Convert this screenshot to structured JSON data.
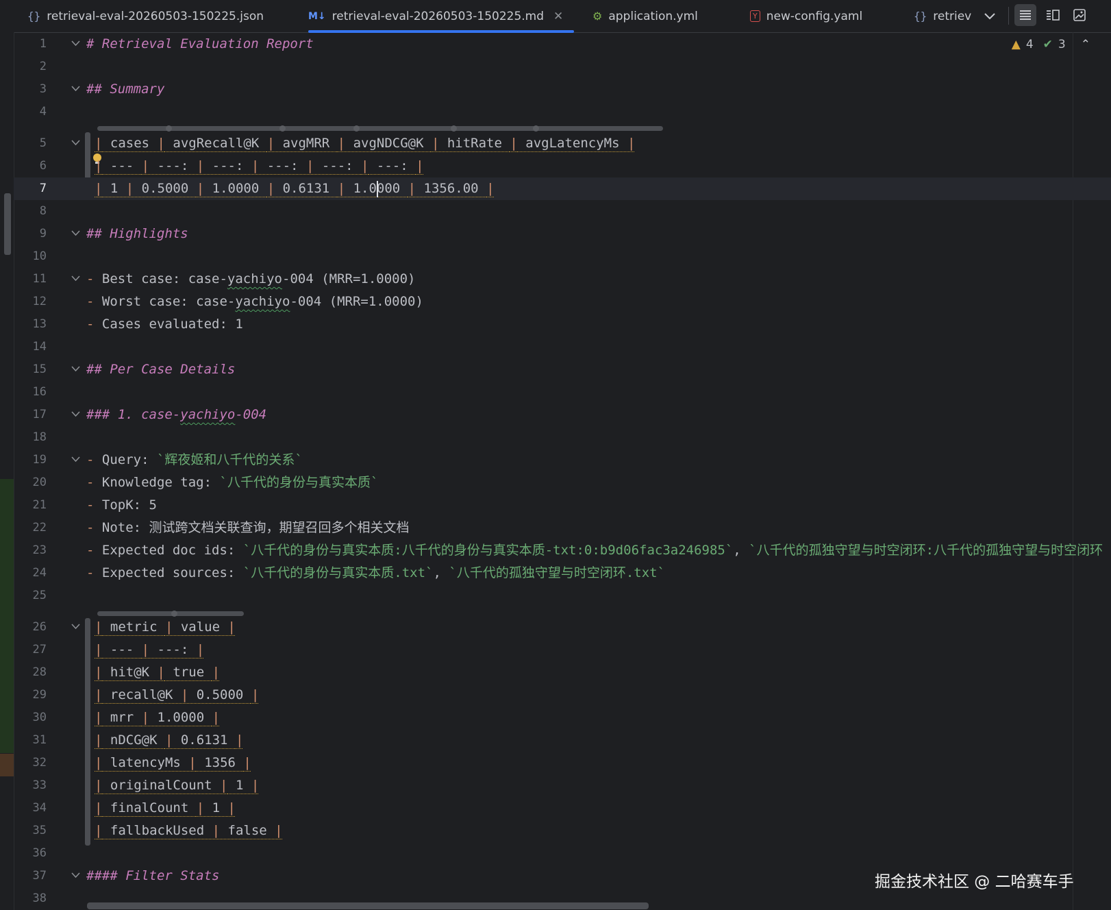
{
  "tabs": [
    {
      "label": "retrieval-eval-20260503-150225.json",
      "icon": "json-file-icon"
    },
    {
      "label": "retrieval-eval-20260503-150225.md",
      "icon": "markdown-file-icon",
      "active": true
    },
    {
      "label": "application.yml",
      "icon": "yml-file-icon"
    },
    {
      "label": "new-config.yaml",
      "icon": "yaml-file-icon"
    },
    {
      "label": "retriev",
      "icon": "json-file-icon"
    }
  ],
  "inspections": {
    "warnings": "4",
    "ok": "3"
  },
  "code_lines": [
    {
      "n": "1",
      "text": "# Retrieval Evaluation Report"
    },
    {
      "n": "2",
      "text": ""
    },
    {
      "n": "3",
      "text": "## Summary"
    },
    {
      "n": "4",
      "text": ""
    },
    {
      "n": "5",
      "text": "| cases | avgRecall@K | avgMRR | avgNDCG@K | hitRate | avgLatencyMs |"
    },
    {
      "n": "6",
      "text": "| --- | ---: | ---: | ---: | ---: | ---: |"
    },
    {
      "n": "7",
      "text": "| 1 | 0.5000 | 1.0000 | 0.6131 | 1.0000 | 1356.00 |"
    },
    {
      "n": "8",
      "text": ""
    },
    {
      "n": "9",
      "text": "## Highlights"
    },
    {
      "n": "10",
      "text": ""
    },
    {
      "n": "11",
      "text": "- Best case: case-yachiyo-004 (MRR=1.0000)"
    },
    {
      "n": "12",
      "text": "- Worst case: case-yachiyo-004 (MRR=1.0000)"
    },
    {
      "n": "13",
      "text": "- Cases evaluated: 1"
    },
    {
      "n": "14",
      "text": ""
    },
    {
      "n": "15",
      "text": "## Per Case Details"
    },
    {
      "n": "16",
      "text": ""
    },
    {
      "n": "17",
      "text": "### 1. case-yachiyo-004"
    },
    {
      "n": "18",
      "text": ""
    },
    {
      "n": "19",
      "text": "- Query: `辉夜姬和八千代的关系`"
    },
    {
      "n": "20",
      "text": "- Knowledge tag: `八千代的身份与真实本质`"
    },
    {
      "n": "21",
      "text": "- TopK: 5"
    },
    {
      "n": "22",
      "text": "- Note: 测试跨文档关联查询，期望召回多个相关文档"
    },
    {
      "n": "23",
      "text": "- Expected doc ids: `八千代的身份与真实本质:八千代的身份与真实本质-txt:0:b9d06fac3a246985`, `八千代的孤独守望与时空闭环:八千代的孤独守望与时空闭环"
    },
    {
      "n": "24",
      "text": "- Expected sources: `八千代的身份与真实本质.txt`, `八千代的孤独守望与时空闭环.txt`"
    },
    {
      "n": "25",
      "text": ""
    },
    {
      "n": "26",
      "text": "| metric | value |"
    },
    {
      "n": "27",
      "text": "| --- | ---: |"
    },
    {
      "n": "28",
      "text": "| hit@K | true |"
    },
    {
      "n": "29",
      "text": "| recall@K | 0.5000 |"
    },
    {
      "n": "30",
      "text": "| mrr | 1.0000 |"
    },
    {
      "n": "31",
      "text": "| nDCG@K | 0.6131 |"
    },
    {
      "n": "32",
      "text": "| latencyMs | 1356 |"
    },
    {
      "n": "33",
      "text": "| originalCount | 1 |"
    },
    {
      "n": "34",
      "text": "| finalCount | 1 |"
    },
    {
      "n": "35",
      "text": "| fallbackUsed | false |"
    },
    {
      "n": "36",
      "text": ""
    },
    {
      "n": "37",
      "text": "#### Filter Stats"
    },
    {
      "n": "38",
      "text": ""
    }
  ],
  "watermark": "掘金技术社区 @ 二哈赛车手"
}
